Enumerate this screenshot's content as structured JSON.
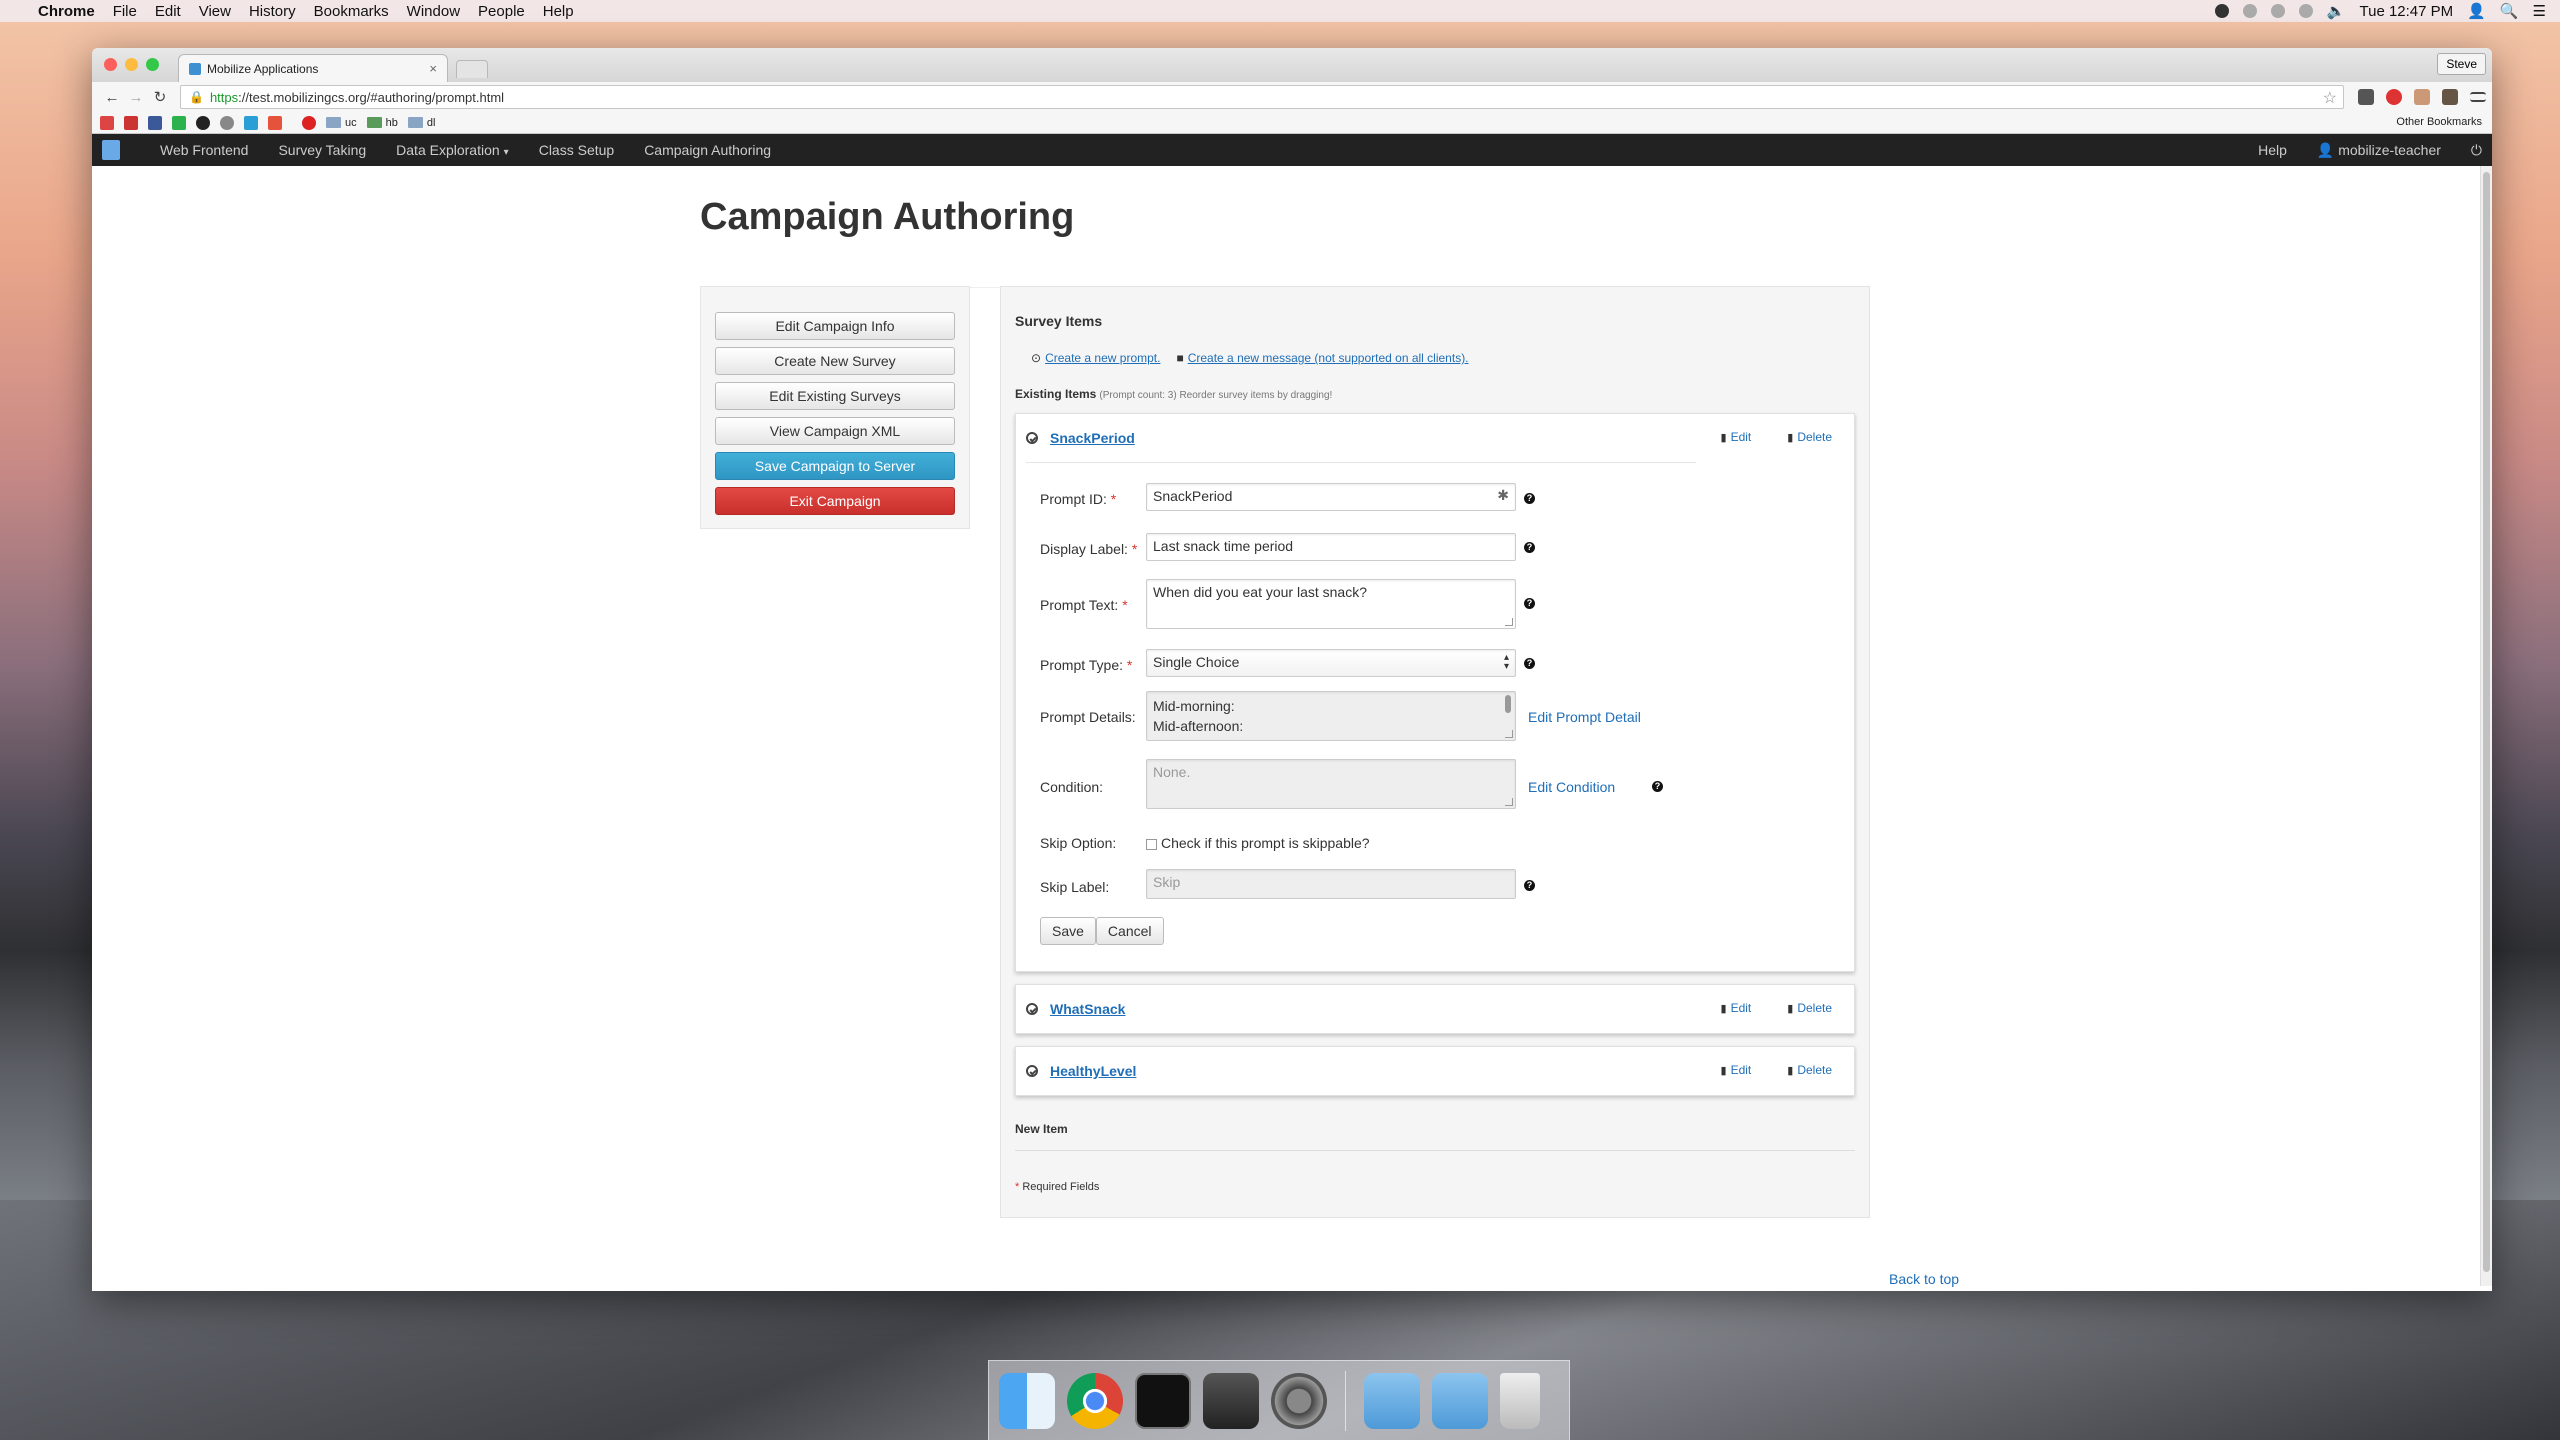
{
  "menubar": {
    "app_name": "Chrome",
    "items": [
      "File",
      "Edit",
      "View",
      "History",
      "Bookmarks",
      "Window",
      "People",
      "Help"
    ],
    "clock": "Tue 12:47 PM"
  },
  "browser": {
    "tab_title": "Mobilize Applications",
    "profile_name": "Steve",
    "url_scheme": "https",
    "url_rest": "://test.mobilizingcs.org/#authoring/prompt.html",
    "bookmarks": [
      "uc",
      "hb",
      "dl"
    ],
    "other_bookmarks": "Other Bookmarks"
  },
  "appnav": {
    "items": [
      "Web Frontend",
      "Survey Taking",
      "Data Exploration",
      "Class Setup",
      "Campaign Authoring"
    ],
    "help": "Help",
    "user": "mobilize-teacher"
  },
  "page": {
    "title": "Campaign Authoring",
    "back_to_top": "Back to top"
  },
  "sidebar": {
    "buttons": [
      "Edit Campaign Info",
      "Create New Survey",
      "Edit Existing Surveys",
      "View Campaign XML",
      "Save Campaign to Server",
      "Exit Campaign"
    ]
  },
  "survey": {
    "heading": "Survey Items",
    "create_prompt": "Create a new prompt.",
    "create_message": "Create a new message (not supported on all clients).",
    "existing_label": "Existing Items",
    "existing_note": "(Prompt count: 3) Reorder survey items by dragging!",
    "edit_label": "Edit",
    "delete_label": "Delete",
    "items": [
      {
        "name": "SnackPeriod"
      },
      {
        "name": "WhatSnack"
      },
      {
        "name": "HealthyLevel"
      }
    ],
    "form": {
      "prompt_id_label": "Prompt ID:",
      "prompt_id_value": "SnackPeriod",
      "display_label_label": "Display Label:",
      "display_label_value": "Last snack time period",
      "prompt_text_label": "Prompt Text:",
      "prompt_text_value": "When did you eat your last snack?",
      "prompt_type_label": "Prompt Type:",
      "prompt_type_value": "Single Choice",
      "prompt_details_label": "Prompt Details:",
      "prompt_details_line1": "Mid-morning:",
      "prompt_details_line2": "Mid-afternoon:",
      "edit_prompt_detail": "Edit Prompt Detail",
      "condition_label": "Condition:",
      "condition_placeholder": "None.",
      "edit_condition": "Edit Condition",
      "skip_option_label": "Skip Option:",
      "skip_checkbox_label": "Check if this prompt is skippable?",
      "skip_label_label": "Skip Label:",
      "skip_label_placeholder": "Skip",
      "save": "Save",
      "cancel": "Cancel",
      "required_star": "*"
    },
    "new_item": "New Item",
    "required_fields": "Required Fields"
  },
  "colors": {
    "link": "#1f6eb7",
    "save_button": "#2f96c4",
    "exit_button": "#c9302c",
    "navbar": "#222222"
  }
}
